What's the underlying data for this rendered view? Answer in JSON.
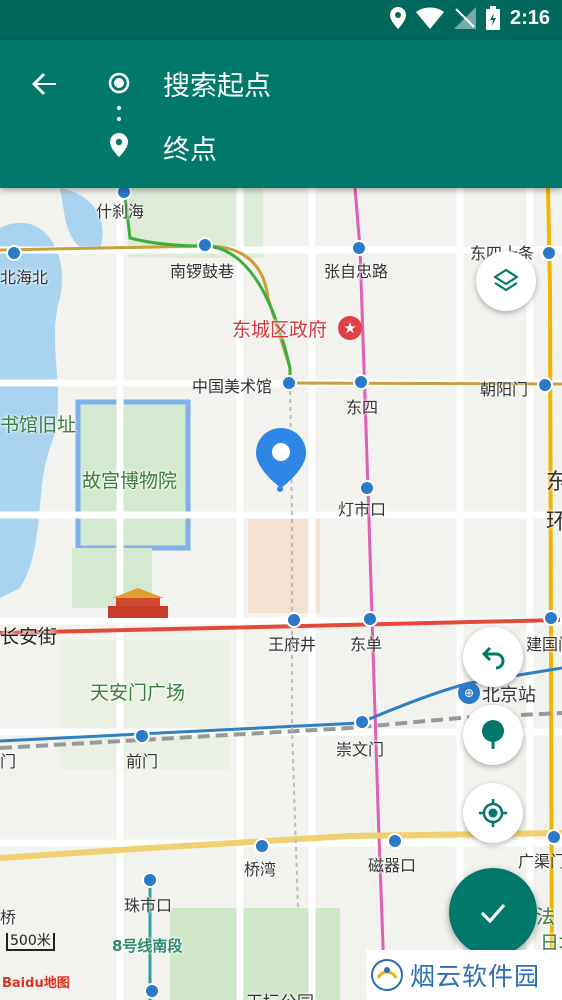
{
  "status_bar": {
    "time": "2:16"
  },
  "app_bar": {
    "start_label": "搜索起点",
    "end_label": "终点"
  },
  "map": {
    "labels": {
      "shichahai": "什刹海",
      "beihai": "北海北",
      "nanluoguxiang": "南锣鼓巷",
      "zhangzizhonglu": "张自忠路",
      "dongsishitiao": "东四十条",
      "dongcheng_gov": "东城区政府",
      "national_art": "中国美术馆",
      "dongsi": "东四",
      "chaoyangmen": "朝阳门",
      "library_old": "书馆旧址",
      "palace_museum": "故宫博物院",
      "dengshikou": "灯市口",
      "changan": "长安街",
      "wangfujing": "王府井",
      "dongdan": "东单",
      "jianguomen": "建国门",
      "tiananmen_square": "天安门广场",
      "beijing_station": "北京站",
      "qianmen": "前门",
      "qianmen_w": "门",
      "chongwenmen": "崇文门",
      "qiaowan": "桥湾",
      "ciqikou": "磁器口",
      "guangqumen": "广渠门",
      "zhushikou": "珠市口",
      "qiao": "桥",
      "line8": "8号线南段",
      "tiantan": "天坛公园",
      "dong_edge": "东",
      "huan_edge": "环",
      "fa_edge": "法",
      "ri_edge": "日坛"
    },
    "scale": "500米",
    "logo": "Baidu地图"
  },
  "watermark": {
    "text": "烟云软件园"
  },
  "colors": {
    "primary": "#00796b",
    "status": "#00695c",
    "pin": "#2e86e6"
  }
}
